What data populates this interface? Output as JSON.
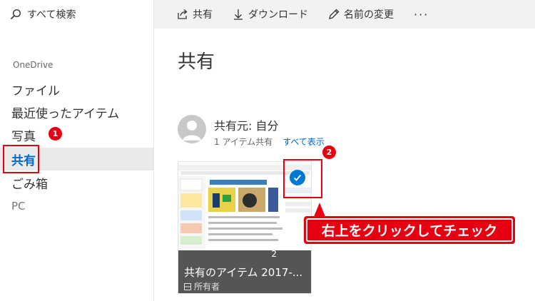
{
  "search": {
    "label": "すべて検索"
  },
  "sidebar": {
    "section": "OneDrive",
    "items": [
      {
        "label": "ファイル"
      },
      {
        "label": "最近使ったアイテム"
      },
      {
        "label": "写真"
      },
      {
        "label": "共有"
      },
      {
        "label": "ごみ箱"
      },
      {
        "label": "PC"
      }
    ]
  },
  "toolbar": {
    "share": "共有",
    "download": "ダウンロード",
    "rename": "名前の変更",
    "more": "···"
  },
  "main": {
    "title": "共有",
    "shared_from": "共有元: 自分",
    "item_count": "1 アイテム共有",
    "show_all": "すべて表示"
  },
  "card": {
    "count": "2",
    "title": "共有のアイテム 2017-...",
    "owner": "所有者"
  },
  "annotations": {
    "badge1": "1",
    "badge2": "2",
    "callout": "右上をクリックしてチェック"
  },
  "colors": {
    "accent": "#0068c9",
    "highlight": "#e60012",
    "check": "#0078d4"
  }
}
